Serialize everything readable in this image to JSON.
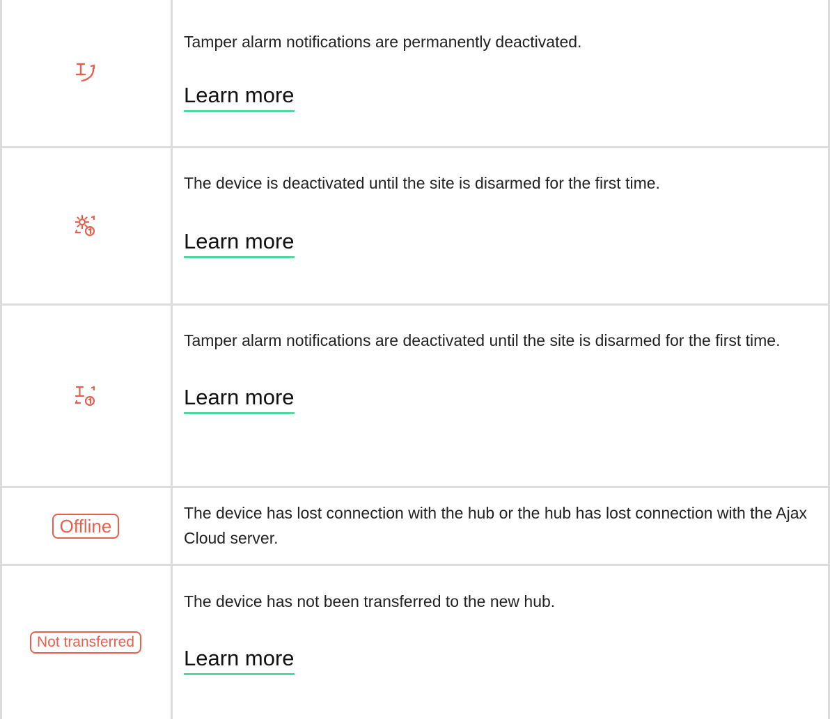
{
  "colors": {
    "accent_red": "#e8604c",
    "underline_green": "#4fd9a0",
    "grid": "#dcdcdc"
  },
  "rows": [
    {
      "icon": "tamper-deactivated-icon",
      "description": "Tamper alarm notifications are permanently deactivated.",
      "link": "Learn more"
    },
    {
      "icon": "gear-deactivated-once-icon",
      "description": "The device is deactivated until the site is disarmed for the first time.",
      "link": "Learn more"
    },
    {
      "icon": "tamper-deactivated-once-icon",
      "description": "Tamper alarm notifications are deactivated until the site is disarmed for the first time.",
      "link": "Learn more"
    },
    {
      "badge": "Offline",
      "description": "The device has lost connection with the hub or the hub has lost connection with the Ajax Cloud server."
    },
    {
      "badge": "Not transferred",
      "description": "The device has not been transferred to the new hub.",
      "link": "Learn more"
    }
  ]
}
